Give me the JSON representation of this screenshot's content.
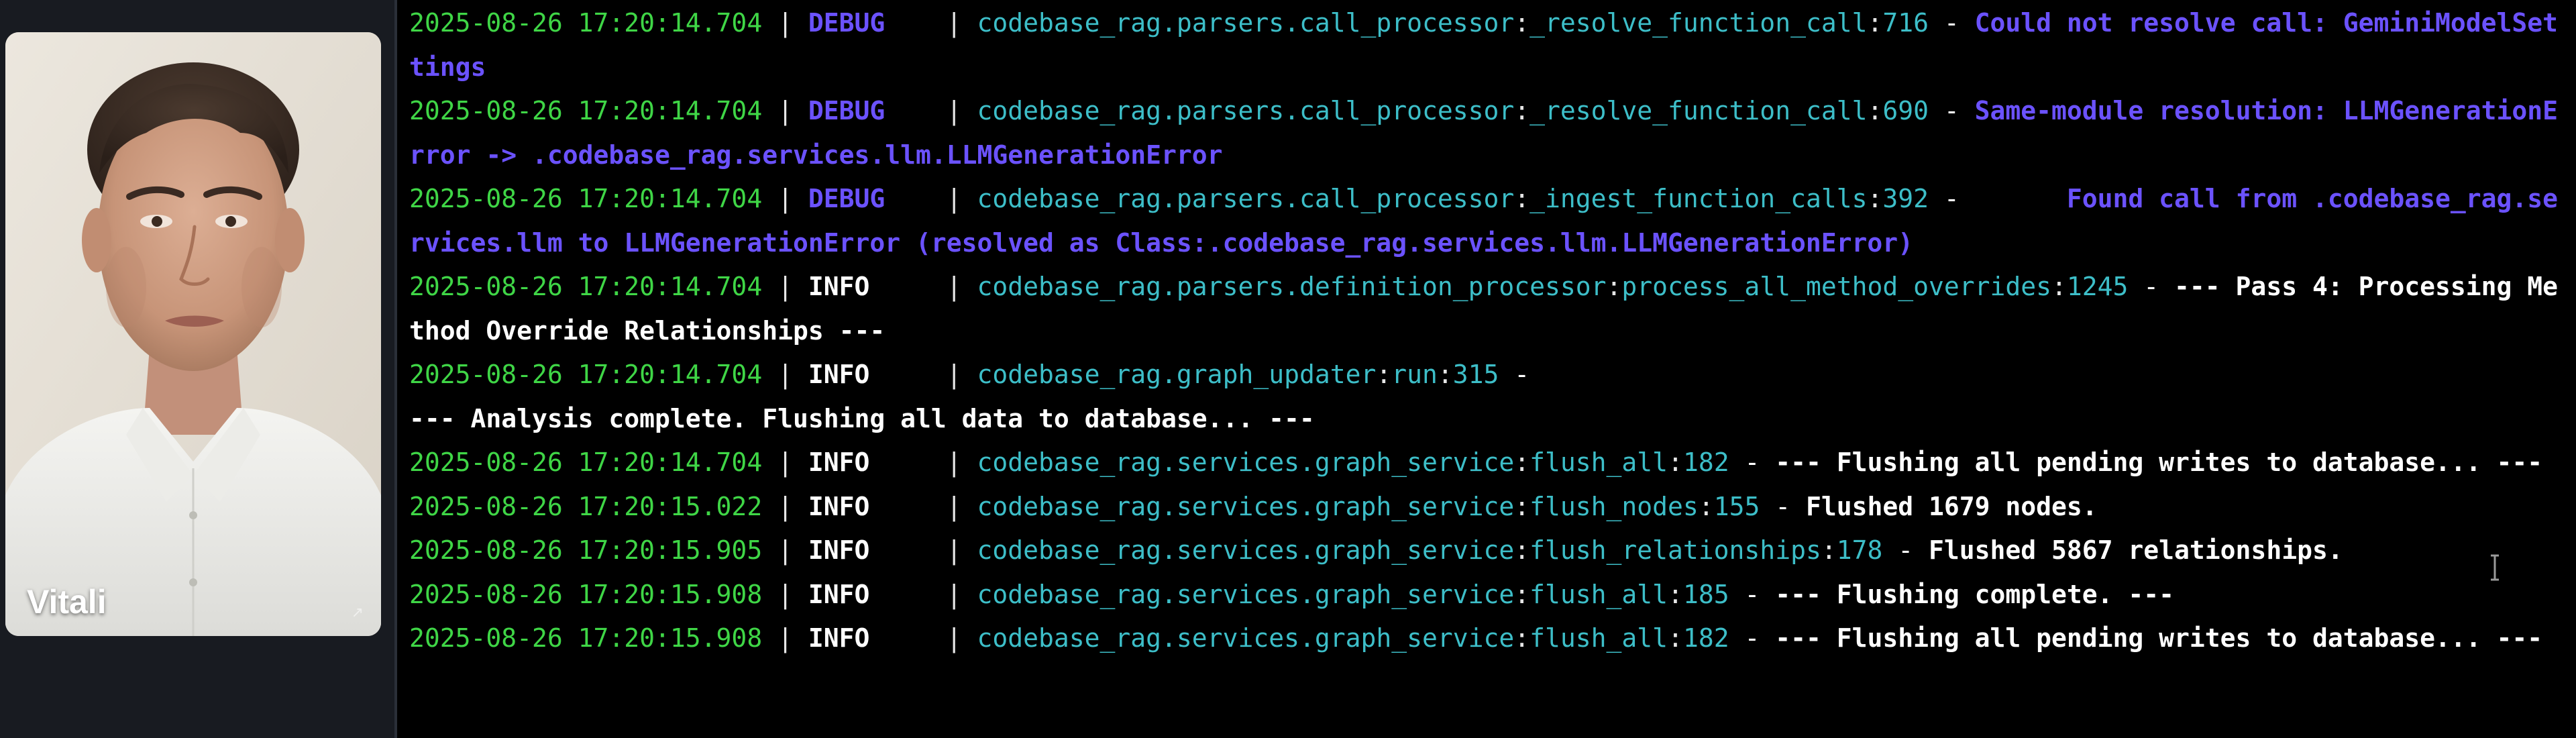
{
  "participant": {
    "name": "Vitali"
  },
  "colors": {
    "timestamp": "#3fd646",
    "debug": "#6b52ff",
    "info": "#ffffff",
    "module": "#3dbec8",
    "terminal_bg": "#000000"
  },
  "log_lines": [
    {
      "timestamp": "2025-08-26 17:20:14.704",
      "level": "DEBUG   ",
      "module": "codebase_rag.parsers.call_processor",
      "function": "_resolve_function_call",
      "line": "716",
      "message": "Could not resolve call: GeminiModelSettings",
      "kind": "debug"
    },
    {
      "timestamp": "2025-08-26 17:20:14.704",
      "level": "DEBUG   ",
      "module": "codebase_rag.parsers.call_processor",
      "function": "_resolve_function_call",
      "line": "690",
      "message": "Same-module resolution: LLMGenerationError -> .codebase_rag.services.llm.LLMGenerationError",
      "kind": "debug"
    },
    {
      "timestamp": "2025-08-26 17:20:14.704",
      "level": "DEBUG   ",
      "module": "codebase_rag.parsers.call_processor",
      "function": "_ingest_function_calls",
      "line": "392",
      "message": "      Found call from .codebase_rag.services.llm to LLMGenerationError (resolved as Class:.codebase_rag.services.llm.LLMGenerationError)",
      "kind": "debug"
    },
    {
      "timestamp": "2025-08-26 17:20:14.704",
      "level": "INFO    ",
      "module": "codebase_rag.parsers.definition_processor",
      "function": "process_all_method_overrides",
      "line": "1245",
      "message": "--- Pass 4: Processing Method Override Relationships ---",
      "kind": "info"
    },
    {
      "timestamp": "2025-08-26 17:20:14.704",
      "level": "INFO    ",
      "module": "codebase_rag.graph_updater",
      "function": "run",
      "line": "315",
      "message": "\n--- Analysis complete. Flushing all data to database... ---",
      "kind": "info"
    },
    {
      "timestamp": "2025-08-26 17:20:14.704",
      "level": "INFO    ",
      "module": "codebase_rag.services.graph_service",
      "function": "flush_all",
      "line": "182",
      "message": "--- Flushing all pending writes to database... ---",
      "kind": "info"
    },
    {
      "timestamp": "2025-08-26 17:20:15.022",
      "level": "INFO    ",
      "module": "codebase_rag.services.graph_service",
      "function": "flush_nodes",
      "line": "155",
      "message": "Flushed 1679 nodes.",
      "kind": "info"
    },
    {
      "timestamp": "2025-08-26 17:20:15.905",
      "level": "INFO    ",
      "module": "codebase_rag.services.graph_service",
      "function": "flush_relationships",
      "line": "178",
      "message": "Flushed 5867 relationships.",
      "kind": "info"
    },
    {
      "timestamp": "2025-08-26 17:20:15.908",
      "level": "INFO    ",
      "module": "codebase_rag.services.graph_service",
      "function": "flush_all",
      "line": "185",
      "message": "--- Flushing complete. ---",
      "kind": "info"
    },
    {
      "timestamp": "2025-08-26 17:20:15.908",
      "level": "INFO    ",
      "module": "codebase_rag.services.graph_service",
      "function": "flush_all",
      "line": "182",
      "message": "--- Flushing all pending writes to database... ---",
      "kind": "info"
    }
  ]
}
